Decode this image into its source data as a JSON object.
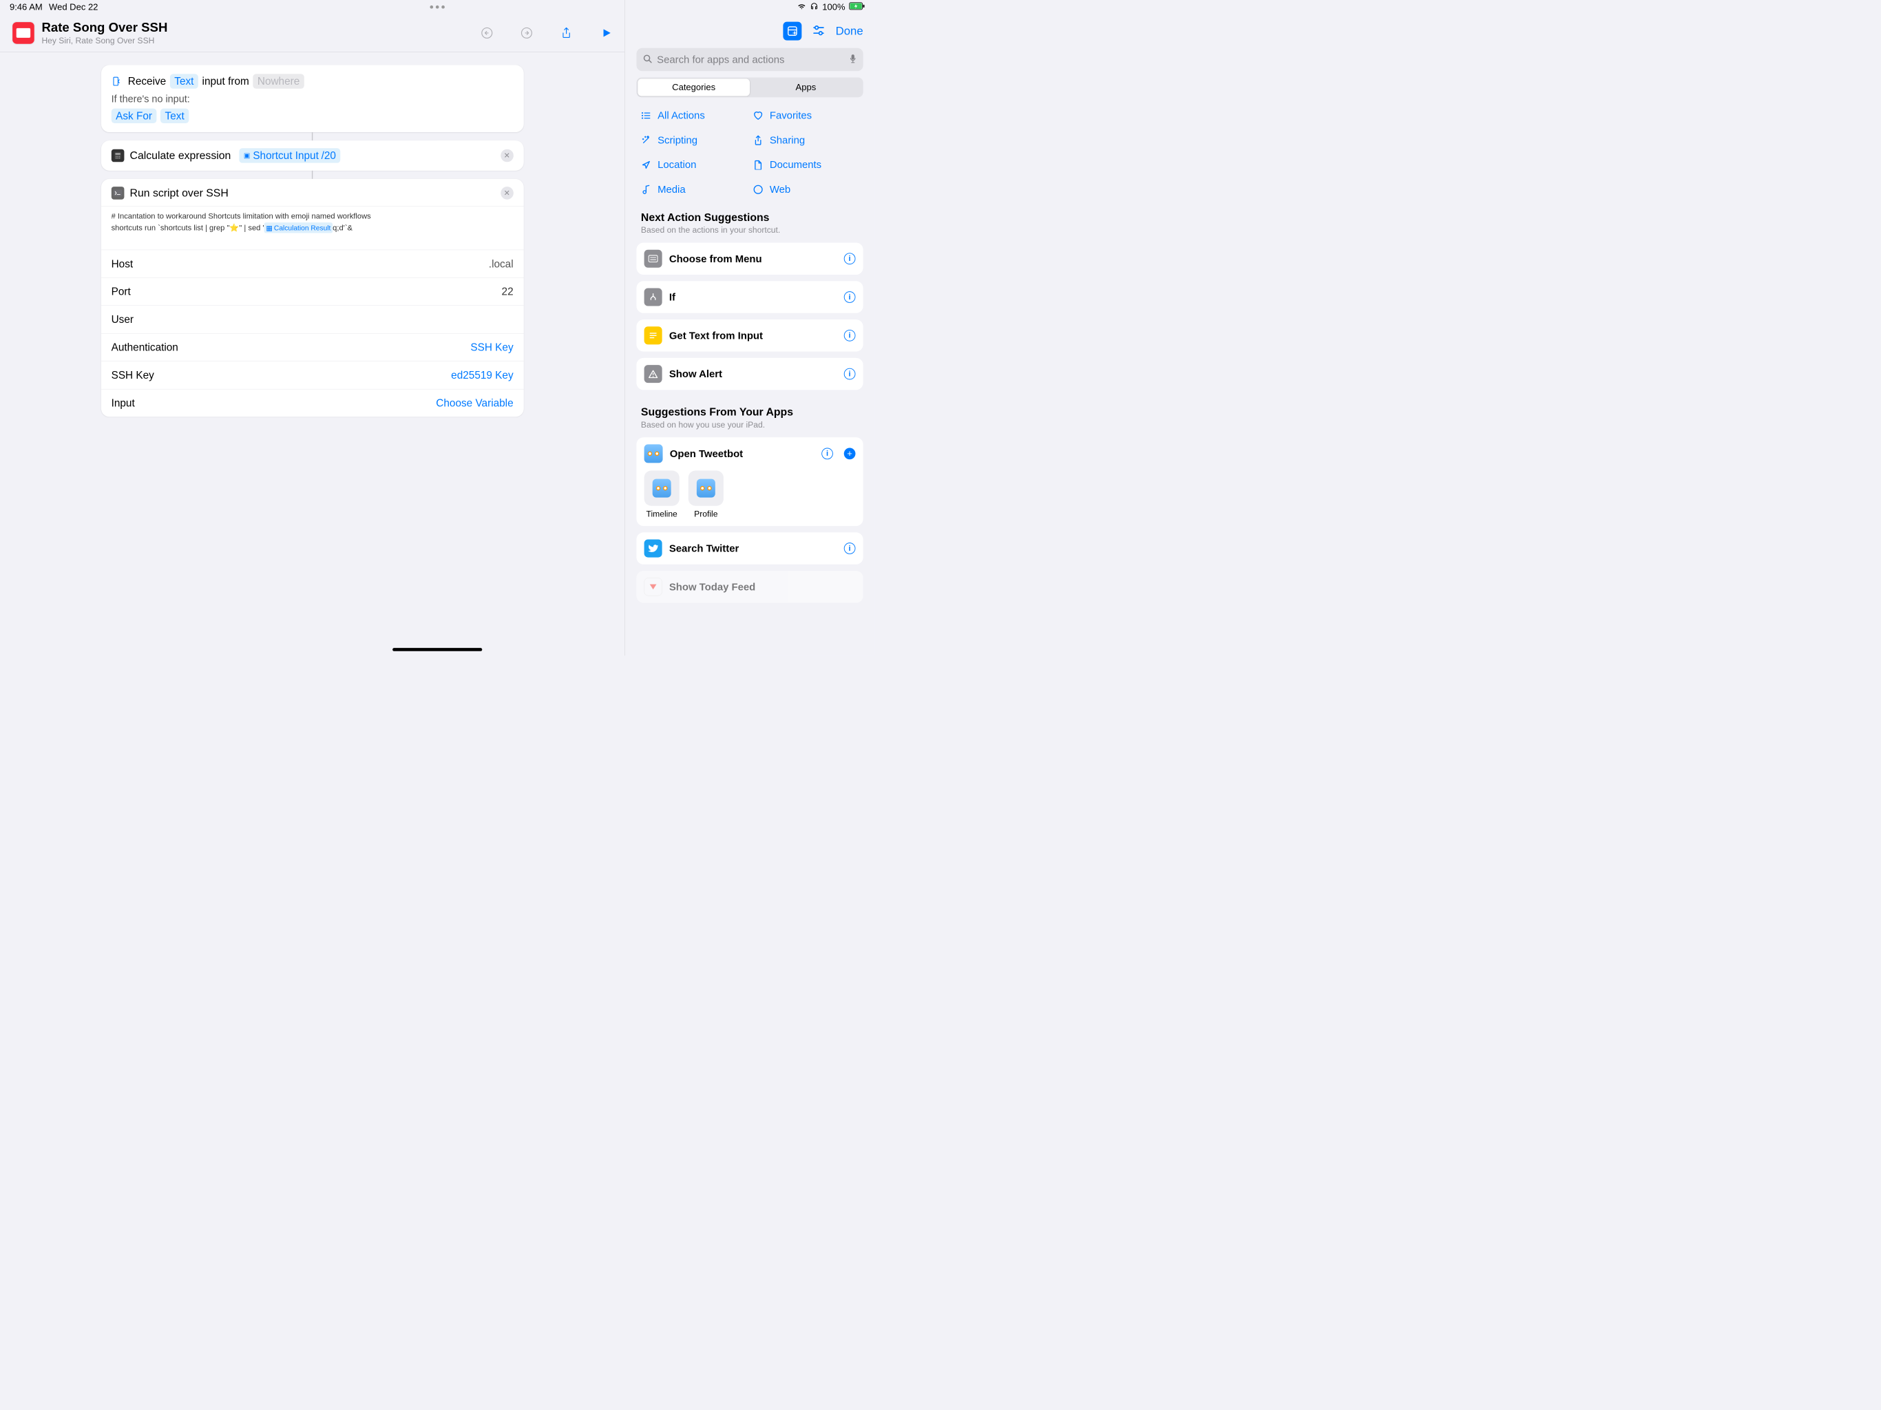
{
  "status": {
    "time": "9:46 AM",
    "date": "Wed Dec 22",
    "battery": "100%"
  },
  "header": {
    "title": "Rate Song Over SSH",
    "subtitle": "Hey Siri, Rate Song Over SSH"
  },
  "receive": {
    "receive_word": "Receive",
    "input_type": "Text",
    "from_word": "input from",
    "source": "Nowhere",
    "noinput_label": "If there's no input:",
    "askfor": "Ask For",
    "text": "Text"
  },
  "calc": {
    "label": "Calculate expression",
    "variable": "Shortcut Input",
    "suffix": "/20"
  },
  "ssh": {
    "title": "Run script over SSH",
    "script_line1": "# Incantation to workaround Shortcuts limitation with emoji named workflows",
    "script_line2_pre": "shortcuts run `shortcuts list | grep \"⭐️\" | sed '",
    "script_var": "Calculation Result",
    "script_line2_post": "q;d'`&",
    "fields": {
      "host_label": "Host",
      "host_value": ".local",
      "port_label": "Port",
      "port_value": "22",
      "user_label": "User",
      "user_value": "",
      "auth_label": "Authentication",
      "auth_value": "SSH Key",
      "sshkey_label": "SSH Key",
      "sshkey_value": "ed25519 Key",
      "input_label": "Input",
      "input_value": "Choose Variable"
    }
  },
  "sidebar": {
    "done": "Done",
    "search_placeholder": "Search for apps and actions",
    "seg_categories": "Categories",
    "seg_apps": "Apps",
    "categories": {
      "all": "All Actions",
      "favorites": "Favorites",
      "scripting": "Scripting",
      "sharing": "Sharing",
      "location": "Location",
      "documents": "Documents",
      "media": "Media",
      "web": "Web"
    },
    "next_suggestions": {
      "title": "Next Action Suggestions",
      "subtitle": "Based on the actions in your shortcut.",
      "items": {
        "choose": "Choose from Menu",
        "if": "If",
        "gettext": "Get Text from Input",
        "alert": "Show Alert"
      }
    },
    "app_suggestions": {
      "title": "Suggestions From Your Apps",
      "subtitle": "Based on how you use your iPad.",
      "tweetbot": "Open Tweetbot",
      "timeline": "Timeline",
      "profile": "Profile",
      "twitter": "Search Twitter",
      "feed": "Show Today Feed"
    }
  }
}
